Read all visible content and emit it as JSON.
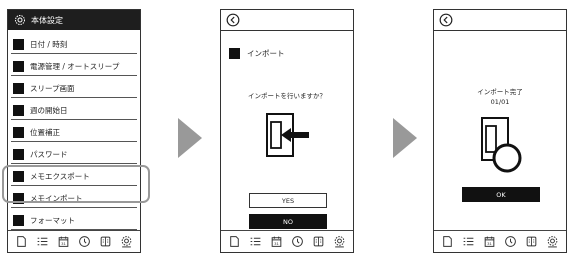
{
  "screen1": {
    "title": "本体設定",
    "menu": [
      "日付 / 時刻",
      "電源管理 / オートスリープ",
      "スリープ画面",
      "週の開始日",
      "位置補正",
      "パスワード",
      "メモエクスポート",
      "メモインポート",
      "フォーマット"
    ],
    "calendar_day": "31"
  },
  "screen2": {
    "title": "インポート",
    "question": "インポートを行いますか？",
    "yes": "YES",
    "no": "NO",
    "calendar_day": "31"
  },
  "screen3": {
    "done": "インポート完了",
    "count": "01/01",
    "ok": "OK",
    "calendar_day": "31"
  }
}
